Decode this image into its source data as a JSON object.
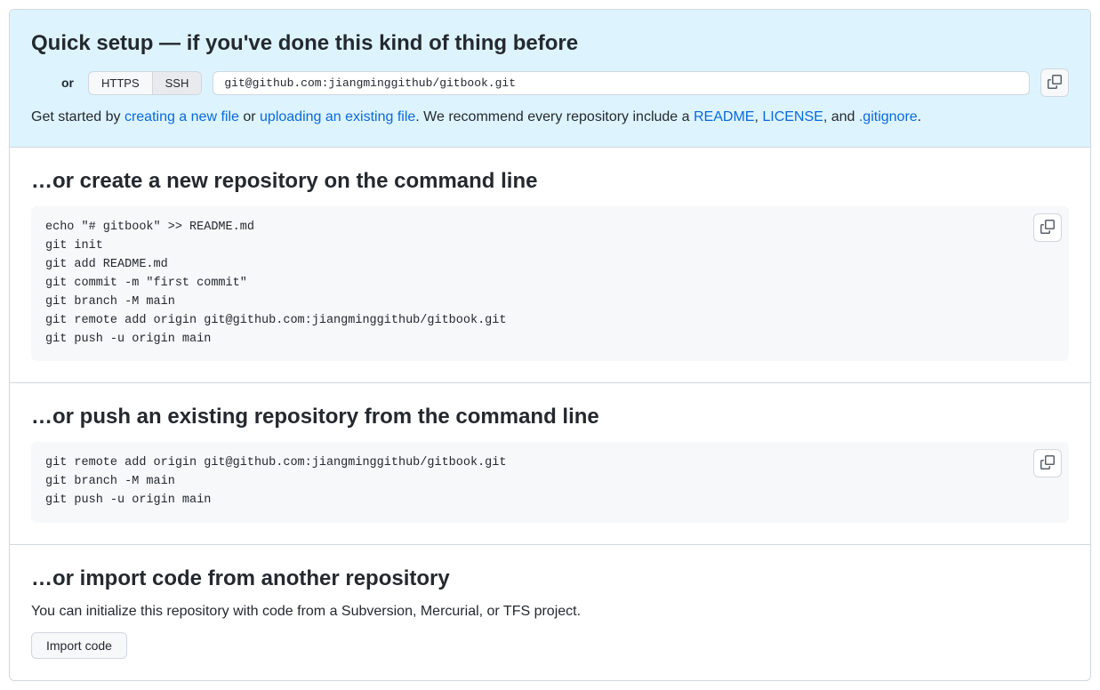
{
  "quick_setup": {
    "heading": "Quick setup — if you've done this kind of thing before",
    "or_label": "or",
    "protocol": {
      "https": "HTTPS",
      "ssh": "SSH",
      "selected": "SSH"
    },
    "url": "git@github.com:jiangminggithub/gitbook.git",
    "get_started": {
      "prefix": "Get started by ",
      "link_create": "creating a new file",
      "or": " or ",
      "link_upload": "uploading an existing file",
      "middle": ". We recommend every repository include a ",
      "link_readme": "README",
      "sep1": ", ",
      "link_license": "LICENSE",
      "sep2": ", and ",
      "link_gitignore": ".gitignore",
      "suffix": "."
    }
  },
  "create_repo": {
    "heading": "…or create a new repository on the command line",
    "code": "echo \"# gitbook\" >> README.md\ngit init\ngit add README.md\ngit commit -m \"first commit\"\ngit branch -M main\ngit remote add origin git@github.com:jiangminggithub/gitbook.git\ngit push -u origin main"
  },
  "push_existing": {
    "heading": "…or push an existing repository from the command line",
    "code": "git remote add origin git@github.com:jiangminggithub/gitbook.git\ngit branch -M main\ngit push -u origin main"
  },
  "import_code": {
    "heading": "…or import code from another repository",
    "text": "You can initialize this repository with code from a Subversion, Mercurial, or TFS project.",
    "button": "Import code"
  }
}
